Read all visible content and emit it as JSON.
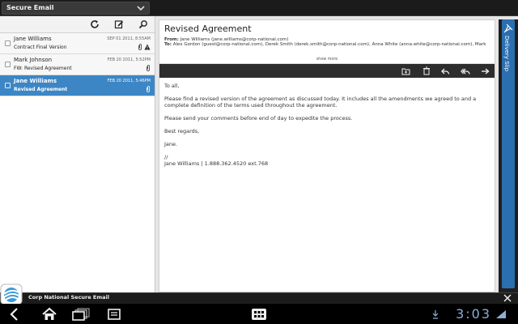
{
  "account": {
    "label": "Secure Email"
  },
  "messages": [
    {
      "sender": "Jane Williams",
      "subject": "Contract Final Version",
      "date": "SEP 01 2011, 8:55AM",
      "attachment": true,
      "warning": true,
      "selected": false
    },
    {
      "sender": "Mark Johnson",
      "subject": "FW: Revised Agreement",
      "date": "FEB 20 2011, 5:52PM",
      "attachment": true,
      "warning": false,
      "selected": false
    },
    {
      "sender": "Jane Williams",
      "subject": "Revised Agreement",
      "date": "FEB 20 2011, 5:46PM",
      "attachment": true,
      "warning": false,
      "selected": true
    }
  ],
  "email": {
    "subject": "Revised Agreement",
    "from_label": "From:",
    "from": "Jane Williams (jane.williams@corp-national.com)",
    "to_label": "To:",
    "to": "Alex Gordon (guest@corp-national.com), Derek Smith (derek.smith@corp-national.com), Anna White (anna.white@corp-national.com), Mark",
    "show_more": "show more",
    "body": {
      "greeting": "To all,",
      "p1": "Please find a revised version of the agreement as discussed today. It includes all the amendments we agreed to and a complete definition of the terms used throughout the agreement.",
      "p2": "Please send your comments before end of day to expedite the process.",
      "closing": "Best regards,",
      "name": "Jane.",
      "sig_sep": "//",
      "signature": "Jane Williams | 1.888.362.4520 ext.768"
    }
  },
  "delivery_slip": {
    "label": "Delivery Slip"
  },
  "footer": {
    "title": "Corp National Secure Email"
  },
  "status": {
    "clock": "3:03"
  },
  "colors": {
    "accent": "#3d86c5",
    "tab": "#2b6fb0"
  }
}
